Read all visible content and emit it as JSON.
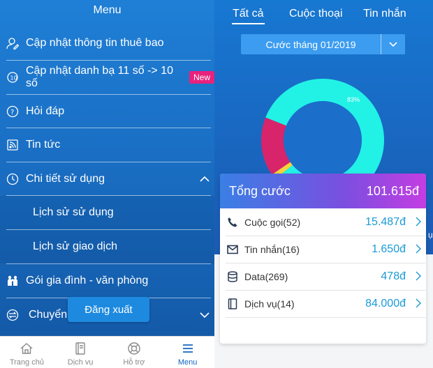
{
  "menu": {
    "title": "Menu",
    "items": [
      {
        "label": "Cập nhật thông tin thuê bao",
        "icon": "user-edit-icon"
      },
      {
        "label": "Cập nhật danh bạ 11 số -> 10 số",
        "icon": "refresh-contacts-icon",
        "badge": "New"
      },
      {
        "label": "Hỏi đáp",
        "icon": "question-icon"
      },
      {
        "label": "Tin tức",
        "icon": "rss-icon"
      },
      {
        "label": "Chi tiết sử dụng",
        "icon": "clock-icon"
      },
      {
        "label": "Lịch sử sử dụng"
      },
      {
        "label": "Lịch sử giao dịch"
      },
      {
        "label": "Gói gia đình - văn phòng",
        "icon": "family-icon"
      },
      {
        "label": "Chuyển",
        "icon": "transfer-icon"
      }
    ],
    "logout_label": "Đăng xuất"
  },
  "bottom_nav": [
    {
      "label": "Trang chủ",
      "icon": "home-icon"
    },
    {
      "label": "Dịch vụ",
      "icon": "book-icon"
    },
    {
      "label": "Hỗ trợ",
      "icon": "support-icon"
    },
    {
      "label": "Menu",
      "icon": "hamburger-icon"
    }
  ],
  "usage": {
    "tabs": [
      "Tất cả",
      "Cuộc thoại",
      "Tin nhắn"
    ],
    "month_label": "Cước tháng 01/2019",
    "donut_percent_label": "83%",
    "total_label": "Tổng cước",
    "total_value": "101.615đ",
    "rows": [
      {
        "label": "Cuộc gọi(52)",
        "value": "15.487đ",
        "icon": "phone-icon"
      },
      {
        "label": "Tin nhắn(16)",
        "value": "1.650đ",
        "icon": "mail-icon"
      },
      {
        "label": "Data(269)",
        "value": "478đ",
        "icon": "database-icon"
      },
      {
        "label": "Dịch vụ(14)",
        "value": "84.000đ",
        "icon": "service-book-icon"
      }
    ],
    "edge_text": "ụ"
  },
  "chart_data": {
    "type": "pie",
    "title": "",
    "labels": [
      "83%"
    ],
    "values": [
      83,
      1.5,
      15.5
    ]
  }
}
